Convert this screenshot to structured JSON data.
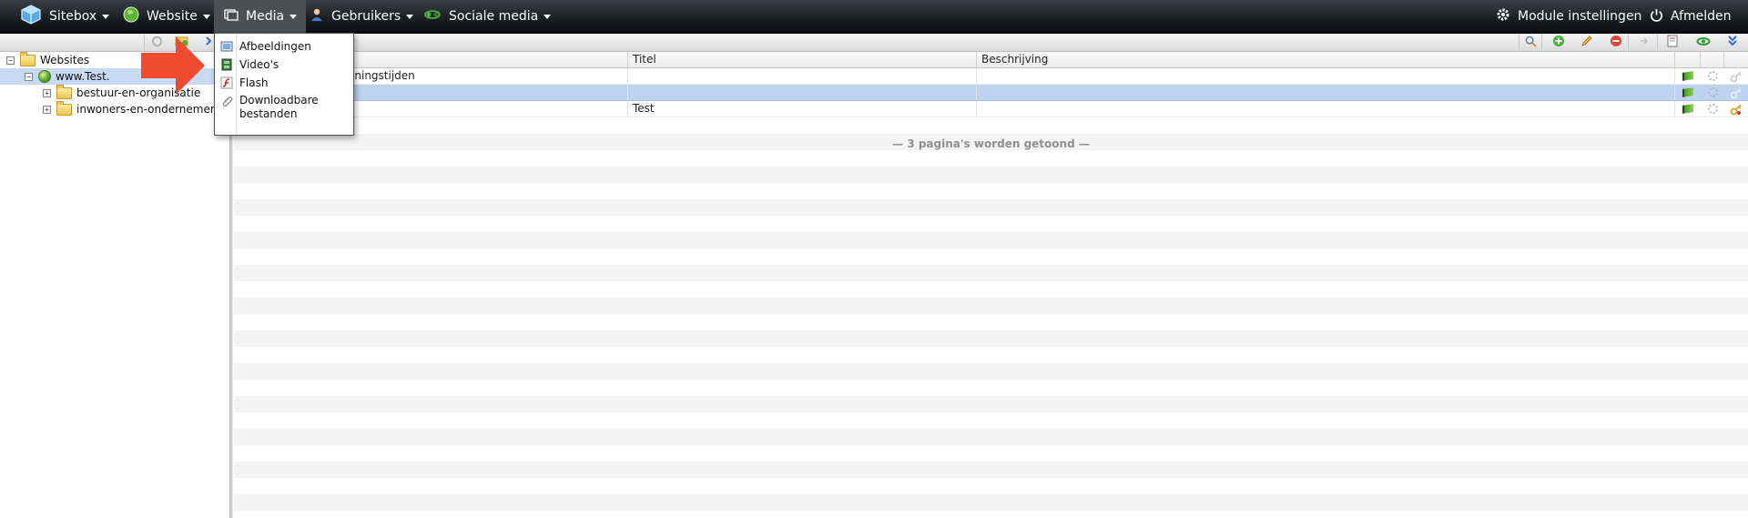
{
  "nav": {
    "left": [
      {
        "label": "Sitebox",
        "icon": "cube-icon"
      },
      {
        "label": "Website",
        "icon": "globe-icon"
      },
      {
        "label": "Media",
        "icon": "media-icon"
      },
      {
        "label": "Gebruikers",
        "icon": "users-icon"
      },
      {
        "label": "Sociale media",
        "icon": "social-icon"
      }
    ],
    "right": [
      {
        "label": "Module instellingen",
        "icon": "gear-icon"
      },
      {
        "label": "Afmelden",
        "icon": "power-icon"
      }
    ]
  },
  "media_menu": {
    "items": [
      {
        "label": "Afbeeldingen",
        "icon": "image-icon"
      },
      {
        "label": "Video's",
        "icon": "film-icon"
      },
      {
        "label": "Flash",
        "icon": "flash-icon"
      },
      {
        "label": "Downloadbare bestanden",
        "icon": "paperclip-icon"
      }
    ]
  },
  "tree": {
    "root": "Websites",
    "site": "www.Test.",
    "folders": [
      "bestuur-en-organisatie",
      "inwoners-en-ondernemers"
    ]
  },
  "grid": {
    "columns": [
      "Titel",
      "Beschrijving"
    ],
    "rows": [
      {
        "page": "eningstijden",
        "title": "",
        "description": ""
      },
      {
        "page": "",
        "title": "",
        "description": ""
      },
      {
        "page": "",
        "title": "Test",
        "description": ""
      }
    ],
    "footer": "— 3 pagina's worden getoond —"
  },
  "colors": {
    "accent_arrow": "#f04a30",
    "selected_row": "#bdd3ef",
    "topbar": "#1c1f24"
  }
}
